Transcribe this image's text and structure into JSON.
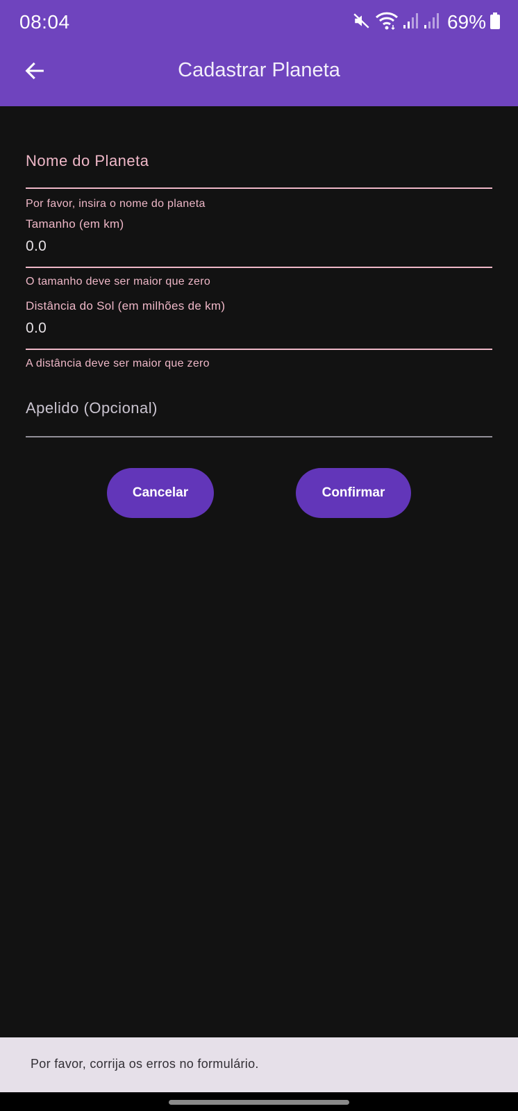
{
  "status_bar": {
    "time": "08:04",
    "battery_percent": "69%",
    "icons": [
      "mute-icon",
      "wifi-icon",
      "signal-icon",
      "signal-icon",
      "battery-icon"
    ]
  },
  "app_bar": {
    "title": "Cadastrar Planeta",
    "back_icon": "arrow-back-icon",
    "background_color": "#6f44be"
  },
  "form": {
    "name_field": {
      "label": "Nome do Planeta",
      "value": "",
      "error": "Por favor, insira o nome do planeta"
    },
    "size_field": {
      "label": "Tamanho (em km)",
      "value": "0.0",
      "error": "O tamanho deve ser maior que zero"
    },
    "distance_field": {
      "label": "Distância do Sol (em milhões de km)",
      "value": "0.0",
      "error": "A distância deve ser maior que zero"
    },
    "nickname_field": {
      "label": "Apelido (Opcional)",
      "value": ""
    }
  },
  "actions": {
    "cancel_label": "Cancelar",
    "confirm_label": "Confirmar",
    "button_color": "#6236b9"
  },
  "snackbar": {
    "message": "Por favor, corrija os erros no formulário."
  },
  "colors": {
    "error": "#efb8c8",
    "background": "#121212"
  }
}
